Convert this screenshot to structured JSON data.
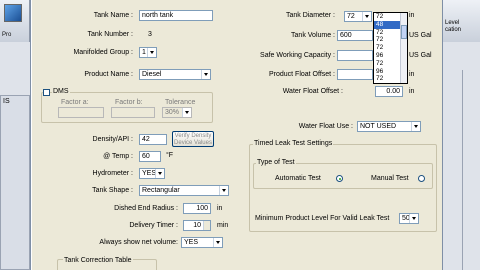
{
  "parent": {
    "left_tool_label": "Pro",
    "left_panel_label": "IS",
    "right_tool_label_1": "Level",
    "right_tool_label_2": "cation"
  },
  "dialog": {
    "tank_name": {
      "label": "Tank Name :",
      "value": "north tank"
    },
    "tank_number": {
      "label": "Tank Number :",
      "value": "3"
    },
    "manifolded_group": {
      "label": "Manifolded Group :",
      "value": "1"
    },
    "product_name": {
      "label": "Product Name :",
      "value": "Diesel"
    },
    "dms": {
      "title": "DMS",
      "factor_a_label": "Factor a:",
      "factor_b_label": "Factor b:",
      "tolerance_label": "Tolerance",
      "tolerance_value": "30%"
    },
    "density": {
      "label": "Density/API :",
      "value": "42",
      "button": "Verify Density Device Values"
    },
    "temp": {
      "label": "@ Temp :",
      "value": "60",
      "unit": "°F"
    },
    "hydrometer": {
      "label": "Hydrometer :",
      "value": "YES"
    },
    "tank_shape": {
      "label": "Tank Shape :",
      "value": "Rectangular"
    },
    "dished_end_radius": {
      "label": "Dished End Radius :",
      "value": "100",
      "unit": "in"
    },
    "delivery_timer": {
      "label": "Delivery Timer :",
      "value": "10",
      "unit": "min"
    },
    "always_show_net": {
      "label": "Always show net volume:",
      "value": "YES"
    },
    "correction_table_label": "Tank Correction Table",
    "tank_diameter": {
      "label": "Tank Diameter :",
      "value": "72",
      "unit": "in",
      "options": [
        "72",
        "48",
        "72",
        "72",
        "72",
        "96",
        "72",
        "96",
        "72",
        "96"
      ],
      "selected_index": 1
    },
    "tank_volume": {
      "label": "Tank Volume :",
      "value": "600",
      "unit": "US Gal"
    },
    "safe_working": {
      "label": "Safe Working Capacity :",
      "unit": "US Gal"
    },
    "product_float_offset": {
      "label": "Product Float Offset :",
      "unit": "in"
    },
    "water_float_offset": {
      "label": "Water Float Offset :",
      "value": "0.00",
      "unit": "in"
    },
    "water_float_use": {
      "label": "Water Float Use :",
      "value": "NOT USED"
    },
    "timed_leak": {
      "title": "Timed Leak Test Settings",
      "type_title": "Type of Test",
      "automatic_label": "Automatic Test",
      "manual_label": "Manual Test",
      "min_level_label": "Minimum Product Level For Valid Leak Test",
      "min_level_value": "50%"
    }
  }
}
